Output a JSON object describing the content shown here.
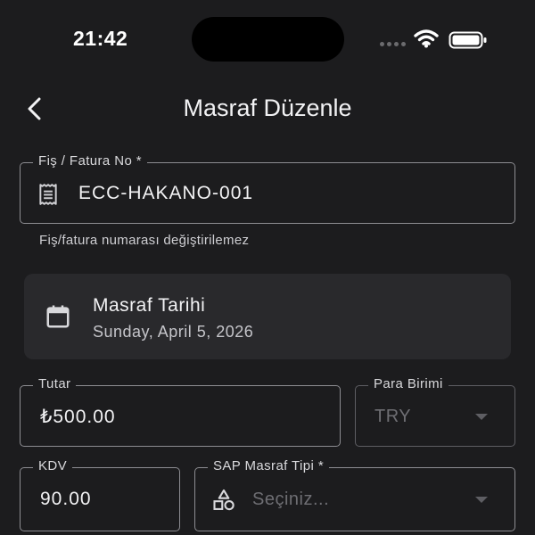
{
  "status_bar": {
    "time": "21:42"
  },
  "nav": {
    "title": "Masraf Düzenle",
    "back_icon": "chevron-left-icon"
  },
  "receipt": {
    "label": "Fiş / Fatura No *",
    "value": "ECC-HAKANO-001",
    "helper": "Fiş/fatura numarası değiştirilemez",
    "icon": "receipt-icon"
  },
  "date": {
    "label": "Masraf Tarihi",
    "value": "Sunday, April 5, 2026",
    "icon": "calendar-icon"
  },
  "amount": {
    "label": "Tutar",
    "value": "₺500.00"
  },
  "currency": {
    "label": "Para Birimi",
    "value": "TRY"
  },
  "vat": {
    "label": "KDV",
    "value": "90.00"
  },
  "sap_type": {
    "label": "SAP Masraf Tipi *",
    "placeholder": "Seçiniz...",
    "icon": "shapes-icon"
  },
  "colors": {
    "background": "#1c1c1e",
    "card": "#29292c",
    "border": "#8d8d92",
    "placeholder": "#6e6e73"
  }
}
